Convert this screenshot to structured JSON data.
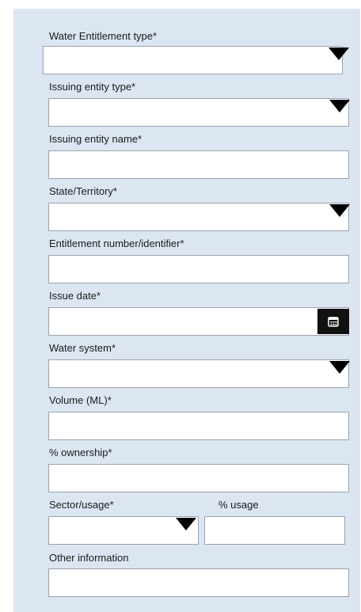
{
  "form": {
    "water_entitlement_type_label": "Water Entitlement type*",
    "issuing_entity_type_label": "Issuing entity type*",
    "issuing_entity_name_label": "Issuing entity name*",
    "state_territory_label": "State/Territory*",
    "entitlement_number_label": "Entitlement number/identifier*",
    "issue_date_label": "Issue date*",
    "water_system_label": "Water system*",
    "volume_label": "Volume (ML)*",
    "ownership_label": "% ownership*",
    "sector_usage_label": "Sector/usage*",
    "usage_percent_label": "% usage",
    "other_information_label": "Other information"
  },
  "icons": {
    "dropdown": "triangle-down-icon",
    "calendar": "calendar-icon"
  },
  "colors": {
    "panel_background": "#dce6f2",
    "field_background": "#ffffff",
    "field_border": "#9aa3ad",
    "arrow": "#000000"
  }
}
